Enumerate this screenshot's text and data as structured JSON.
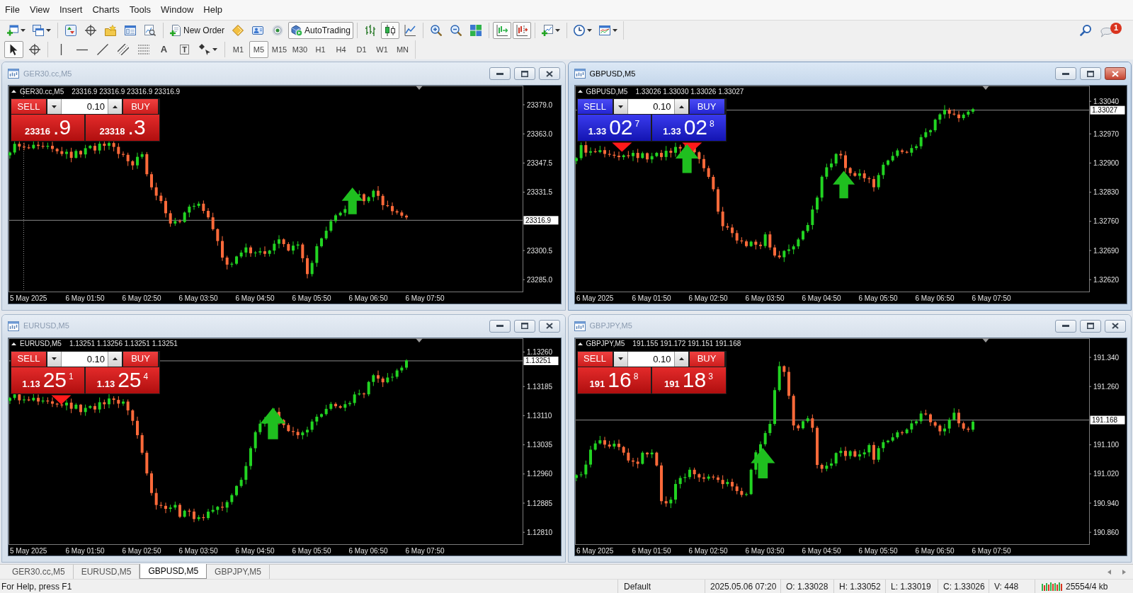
{
  "menu": [
    "File",
    "View",
    "Insert",
    "Charts",
    "Tools",
    "Window",
    "Help"
  ],
  "toolbar": {
    "new_order": "New Order",
    "autotrading": {
      "label": "AutoTrading",
      "on": true
    },
    "chart_types": [
      {
        "selected": false
      },
      {
        "selected": true
      },
      {
        "selected": false
      }
    ],
    "auto_scroll": {
      "on": true
    },
    "chart_shift": {
      "on": true
    },
    "notifications": {
      "count": "1"
    }
  },
  "drawing_toolbar": {
    "pointer_tools": [
      {
        "selected": true
      },
      {
        "selected": false
      }
    ],
    "text_tool": "A",
    "label_tool": "T",
    "timeframes": [
      {
        "label": "M1",
        "selected": false
      },
      {
        "label": "M5",
        "selected": true
      },
      {
        "label": "M15",
        "selected": false
      },
      {
        "label": "M30",
        "selected": false
      },
      {
        "label": "H1",
        "selected": false
      },
      {
        "label": "H4",
        "selected": false
      },
      {
        "label": "D1",
        "selected": false
      },
      {
        "label": "W1",
        "selected": false
      },
      {
        "label": "MN",
        "selected": false
      }
    ]
  },
  "charts": [
    {
      "title": "GER30.cc,M5",
      "active": false,
      "symbol": "GER30.cc,M5",
      "quote": "23316.9 23316.9 23316.9 23316.9",
      "trade_panel": {
        "rising": false,
        "sell_label": "SELL",
        "lot": "0.10",
        "buy_label": "BUY",
        "sell_price": {
          "prefix": "23316",
          "digits": ".9"
        },
        "buy_price": {
          "prefix": "23318",
          "digits": ".3"
        }
      },
      "price_labels": [
        "23379.0",
        "23363.0",
        "23347.5",
        "23331.5",
        "23300.5",
        "23285.0"
      ],
      "current_price": "23316.9",
      "time_labels": [
        "5 May 2025",
        "6 May 01:50",
        "6 May 02:50",
        "6 May 03:50",
        "6 May 04:50",
        "6 May 05:50",
        "6 May 06:50",
        "6 May 07:50"
      ]
    },
    {
      "title": "GBPUSD,M5",
      "active": true,
      "symbol": "GBPUSD,M5",
      "quote": "1.33026 1.33030 1.33026 1.33027",
      "trade_panel": {
        "rising": true,
        "sell_label": "SELL",
        "lot": "0.10",
        "buy_label": "BUY",
        "sell_price": {
          "prefix": "1.33",
          "digits": "02",
          "pip": "7"
        },
        "buy_price": {
          "prefix": "1.33",
          "digits": "02",
          "pip": "8"
        }
      },
      "price_labels": [
        "1.33040",
        "1.32970",
        "1.32900",
        "1.32830",
        "1.32760",
        "1.32690",
        "1.32620"
      ],
      "current_price": "1.33027",
      "time_labels": [
        "6 May 2025",
        "6 May 01:50",
        "6 May 02:50",
        "6 May 03:50",
        "6 May 04:50",
        "6 May 05:50",
        "6 May 06:50",
        "6 May 07:50"
      ]
    },
    {
      "title": "EURUSD,M5",
      "active": false,
      "symbol": "EURUSD,M5",
      "quote": "1.13251 1.13256 1.13251 1.13251",
      "trade_panel": {
        "rising": false,
        "sell_label": "SELL",
        "lot": "0.10",
        "buy_label": "BUY",
        "sell_price": {
          "prefix": "1.13",
          "digits": "25",
          "pip": "1"
        },
        "buy_price": {
          "prefix": "1.13",
          "digits": "25",
          "pip": "4"
        }
      },
      "price_labels": [
        "1.13260",
        "1.13185",
        "1.13110",
        "1.13035",
        "1.12960",
        "1.12885",
        "1.12810"
      ],
      "current_price": "1.13251",
      "time_labels": [
        "5 May 2025",
        "6 May 01:50",
        "6 May 02:50",
        "6 May 03:50",
        "6 May 04:50",
        "6 May 05:50",
        "6 May 06:50",
        "6 May 07:50"
      ]
    },
    {
      "title": "GBPJPY,M5",
      "active": false,
      "symbol": "GBPJPY,M5",
      "quote": "191.155 191.172 191.151 191.168",
      "trade_panel": {
        "rising": false,
        "sell_label": "SELL",
        "lot": "0.10",
        "buy_label": "BUY",
        "sell_price": {
          "prefix": "191",
          "digits": "16",
          "pip": "8"
        },
        "buy_price": {
          "prefix": "191",
          "digits": "18",
          "pip": "3"
        }
      },
      "price_labels": [
        "191.340",
        "191.260",
        "191.100",
        "191.020",
        "190.940",
        "190.860"
      ],
      "current_price": "191.168",
      "time_labels": [
        "6 May 2025",
        "6 May 01:50",
        "6 May 02:50",
        "6 May 03:50",
        "6 May 04:50",
        "6 May 05:50",
        "6 May 06:50",
        "6 May 07:50"
      ]
    }
  ],
  "tabs": [
    {
      "label": "GER30.cc,M5",
      "selected": false
    },
    {
      "label": "EURUSD,M5",
      "selected": false
    },
    {
      "label": "GBPUSD,M5",
      "selected": true
    },
    {
      "label": "GBPJPY,M5",
      "selected": false
    }
  ],
  "status_bar": {
    "help": "For Help, press F1",
    "profile": "Default",
    "datetime": "2025.05.06 07:20",
    "open": "O: 1.33028",
    "high": "H: 1.33052",
    "low": "L: 1.33019",
    "close": "C: 1.33026",
    "volume": "V: 448",
    "traffic": "25554/4 kb"
  }
}
